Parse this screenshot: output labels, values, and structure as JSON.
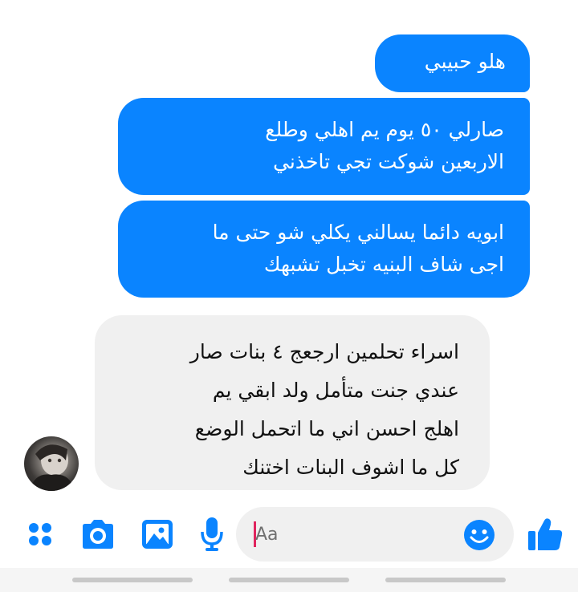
{
  "messages": [
    {
      "direction": "outgoing",
      "text": "هلو حبيبي"
    },
    {
      "direction": "outgoing",
      "text": "صارلي ٥٠ يوم يم اهلي وطلع\nالاربعين شوكت تجي تاخذني"
    },
    {
      "direction": "outgoing",
      "text": "ابويه دائما يسالني يكلي شو حتى ما\nاجى شاف البنيه تخبل تشبهك"
    },
    {
      "direction": "incoming",
      "text": "اسراء تحلمين ارجعج ٤ بنات صار\nعندي جنت متأمل ولد ابقي يم\nاهلج احسن اني ما اتحمل الوضع\nكل ما اشوف البنات اختنك"
    }
  ],
  "contact": {
    "avatar_icon": "contact-avatar"
  },
  "composer": {
    "placeholder": "Aa",
    "value": "",
    "tools": [
      "apps-icon",
      "camera-icon",
      "gallery-icon",
      "microphone-icon"
    ],
    "emoji_icon": "emoji-icon",
    "send_icon": "thumbs-up-icon"
  },
  "colors": {
    "accent": "#0a84ff",
    "incoming_bubble": "#f0f0f0",
    "outgoing_text": "#ffffff",
    "incoming_text": "#111111"
  }
}
